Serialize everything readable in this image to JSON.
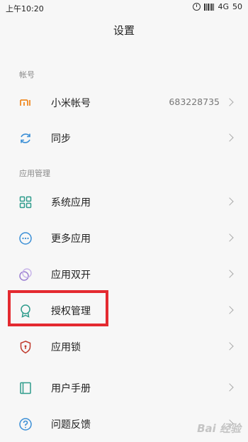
{
  "status_bar": {
    "time": "上午10:20",
    "network": "4G",
    "battery": "50"
  },
  "header": {
    "title": "设置"
  },
  "sections": [
    {
      "title": "帐号"
    },
    {
      "title": "应用管理"
    }
  ],
  "account_items": [
    {
      "label": "小米帐号",
      "value": "683228735",
      "icon": "mi-logo-icon"
    },
    {
      "label": "同步",
      "icon": "sync-icon"
    }
  ],
  "app_items": [
    {
      "label": "系统应用",
      "icon": "grid-apps-icon"
    },
    {
      "label": "更多应用",
      "icon": "more-dots-icon"
    },
    {
      "label": "应用双开",
      "icon": "dual-apps-icon"
    },
    {
      "label": "授权管理",
      "icon": "permission-badge-icon"
    },
    {
      "label": "应用锁",
      "icon": "shield-lock-icon"
    },
    {
      "label": "用户手册",
      "icon": "manual-book-icon"
    },
    {
      "label": "问题反馈",
      "icon": "question-icon"
    }
  ],
  "watermark": "Bai 经验",
  "colors": {
    "accent_orange": "#f08a24",
    "accent_teal": "#2f9c8c",
    "highlight_red": "#e42a30"
  }
}
